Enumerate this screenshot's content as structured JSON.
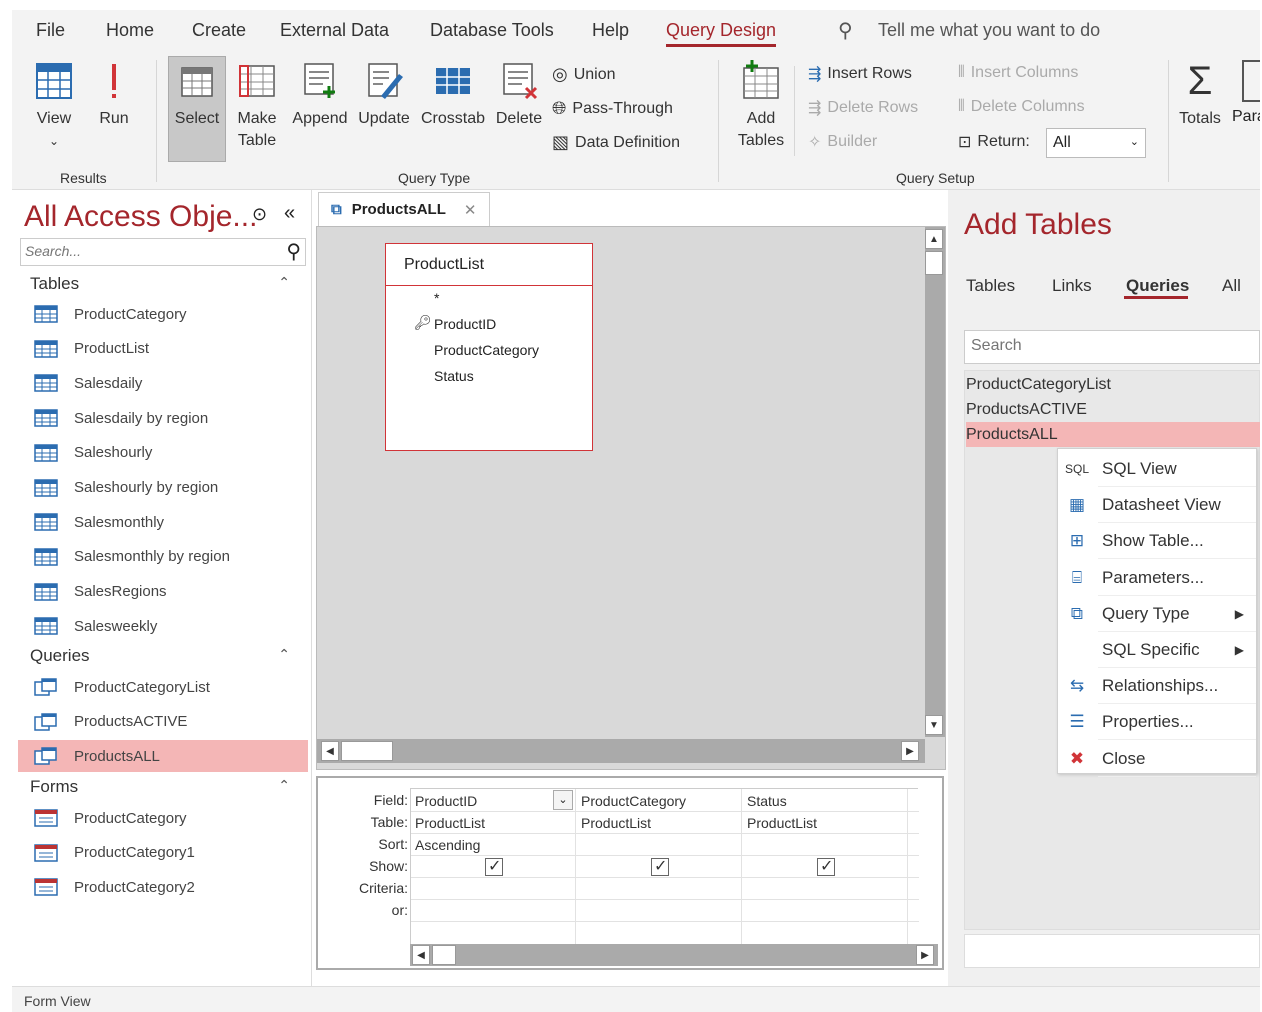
{
  "ribbon": {
    "tabs": [
      "File",
      "Home",
      "Create",
      "External Data",
      "Database Tools",
      "Help",
      "Query Design"
    ],
    "active_tab": "Query Design",
    "tell_me": "Tell me what you want to do",
    "results": {
      "view": "View",
      "run": "Run",
      "group": "Results"
    },
    "query_type": {
      "select": "Select",
      "make_table_1": "Make",
      "make_table_2": "Table",
      "append": "Append",
      "update": "Update",
      "crosstab": "Crosstab",
      "delete": "Delete",
      "union": "Union",
      "pass_through": "Pass-Through",
      "data_definition": "Data Definition",
      "group": "Query Type"
    },
    "query_setup": {
      "add_tables_1": "Add",
      "add_tables_2": "Tables",
      "insert_rows": "Insert Rows",
      "delete_rows": "Delete Rows",
      "builder": "Builder",
      "insert_columns": "Insert Columns",
      "delete_columns": "Delete Columns",
      "return_label": "Return:",
      "return_value": "All",
      "group": "Query Setup"
    },
    "totals": "Totals",
    "para": "Para"
  },
  "nav": {
    "title": "All Access Obje...",
    "search_placeholder": "Search...",
    "sections": {
      "tables": "Tables",
      "queries": "Queries",
      "forms": "Forms"
    },
    "tables": [
      "ProductCategory",
      "ProductList",
      "Salesdaily",
      "Salesdaily by region",
      "Saleshourly",
      "Saleshourly by region",
      "Salesmonthly",
      "Salesmonthly by region",
      "SalesRegions",
      "Salesweekly"
    ],
    "queries": [
      "ProductCategoryList",
      "ProductsACTIVE",
      "ProductsALL"
    ],
    "forms": [
      "ProductCategory",
      "ProductCategory1",
      "ProductCategory2"
    ],
    "selected_query": "ProductsALL"
  },
  "document": {
    "tab_label": "ProductsALL",
    "table_box": {
      "title": "ProductList",
      "fields": [
        "*",
        "ProductID",
        "ProductCategory",
        "Status"
      ]
    },
    "grid": {
      "row_labels": [
        "Field:",
        "Table:",
        "Sort:",
        "Show:",
        "Criteria:",
        "or:"
      ],
      "columns": [
        {
          "field": "ProductID",
          "table": "ProductList",
          "sort": "Ascending",
          "show": true
        },
        {
          "field": "ProductCategory",
          "table": "ProductList",
          "sort": "",
          "show": true
        },
        {
          "field": "Status",
          "table": "ProductList",
          "sort": "",
          "show": true
        }
      ]
    }
  },
  "add_tables": {
    "title": "Add Tables",
    "tabs": [
      "Tables",
      "Links",
      "Queries",
      "All"
    ],
    "active_tab": "Queries",
    "search_placeholder": "Search",
    "items": [
      "ProductCategoryList",
      "ProductsACTIVE",
      "ProductsALL"
    ],
    "selected": "ProductsALL"
  },
  "context_menu": {
    "items": [
      {
        "icon": "sql-icon",
        "label": "SQL View"
      },
      {
        "icon": "datasheet-icon",
        "label": "Datasheet View"
      },
      {
        "icon": "show-table-icon",
        "label": "Show Table..."
      },
      {
        "icon": "parameters-icon",
        "label": "Parameters..."
      },
      {
        "icon": "query-type-icon",
        "label": "Query Type",
        "submenu": true
      },
      {
        "icon": "",
        "label": "SQL Specific",
        "submenu": true
      },
      {
        "icon": "relationships-icon",
        "label": "Relationships..."
      },
      {
        "icon": "properties-icon",
        "label": "Properties..."
      },
      {
        "icon": "close-icon",
        "label": "Close"
      }
    ],
    "sql_glyph": "SQL"
  },
  "status_bar": "Form View",
  "colors": {
    "accent": "#a4262c",
    "selected_bg": "#f4b6b6",
    "ribbon_bg": "#f3f3f3"
  }
}
